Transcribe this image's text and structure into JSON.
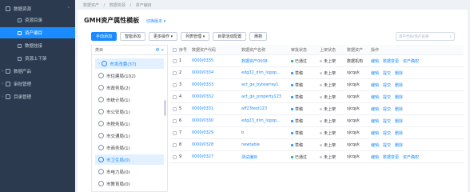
{
  "sidebar": {
    "groups": [
      {
        "label": "数据资源",
        "expanded": true
      },
      {
        "label": "数据产品",
        "expanded": false
      },
      {
        "label": "审批管理",
        "expanded": false
      },
      {
        "label": "目录管理",
        "expanded": false
      }
    ],
    "sub_items": [
      {
        "label": "资源目录"
      },
      {
        "label": "资产编目",
        "active": true
      },
      {
        "label": "数据挂接"
      },
      {
        "label": "资源上下架"
      }
    ]
  },
  "breadcrumb": [
    "数据资产",
    "/",
    "数据资源",
    "/",
    "资产编目"
  ],
  "panel": {
    "title": "GMH资产属性模板",
    "switch_label": "切换版本 ▾"
  },
  "toolbar": {
    "buttons": [
      "手动添加",
      "智能添加",
      "更多操作 ▾",
      "列表管理 ▾",
      "目录活动配置",
      "刷新"
    ]
  },
  "search": {
    "placeholder": "资产代码/资产名称"
  },
  "tree": {
    "header": "类目",
    "items": [
      {
        "label": "市发改委(37)",
        "selected": true
      },
      {
        "label": "市住建局(102)"
      },
      {
        "label": "市政务局(2)"
      },
      {
        "label": "市统计局(1)"
      },
      {
        "label": "市公安局(1)"
      },
      {
        "label": "市税务局(1)"
      },
      {
        "label": "市交通局(1)"
      },
      {
        "label": "市商务局(1)"
      },
      {
        "label": "市卫生局(0)",
        "highlight": true
      },
      {
        "label": "市电力局(0)"
      },
      {
        "label": "市教育局(0)"
      }
    ]
  },
  "table": {
    "headers": [
      "序号",
      "数据资产代码",
      "数据资产名称",
      "审批状态",
      "上架状态",
      "数据资产",
      "操作"
    ],
    "rows": [
      {
        "no": "1",
        "code": "0000/0335",
        "name": "数据资产0008",
        "audit": "已通过",
        "audit_color": "#1aa86b",
        "pub": "未上架",
        "prod": "数据机构",
        "ops": [
          "编辑",
          "数据变更",
          "资产确权"
        ]
      },
      {
        "no": "2",
        "code": "0000/0334",
        "name": "edg32_dim_logop...",
        "audit": "草稿",
        "audit_color": "#1a8cff",
        "pub": "未上架",
        "prod": "sjcqyk",
        "ops": [
          "编辑",
          "提交",
          "删除"
        ]
      },
      {
        "no": "3",
        "code": "0000/0333",
        "name": "act_ge_bytearray1",
        "audit": "草稿",
        "audit_color": "#1a8cff",
        "pub": "未上架",
        "prod": "sjcqyk",
        "ops": [
          "编辑",
          "提交",
          "删除"
        ]
      },
      {
        "no": "4",
        "code": "0000/0332",
        "name": "act_ge_property123",
        "audit": "草稿",
        "audit_color": "#1a8cff",
        "pub": "未上架",
        "prod": "sjcqyk",
        "ops": [
          "编辑",
          "提交",
          "删除"
        ]
      },
      {
        "no": "5",
        "code": "0000/0331",
        "name": "aff23test123",
        "audit": "草稿",
        "audit_color": "#1a8cff",
        "pub": "未上架",
        "prod": "sjcqyk",
        "ops": [
          "编辑",
          "提交",
          "删除"
        ]
      },
      {
        "no": "6",
        "code": "0000/0330",
        "name": "edg23_dim_logop...",
        "audit": "草稿",
        "audit_color": "#1a8cff",
        "pub": "未上架",
        "prod": "sjcqyk",
        "ops": [
          "编辑",
          "提交",
          "删除"
        ]
      },
      {
        "no": "7",
        "code": "0000/0329",
        "name": "b",
        "audit": "草稿",
        "audit_color": "#1a8cff",
        "pub": "未上架",
        "prod": "sjcqyk",
        "ops": [
          "编辑",
          "提交",
          "删除"
        ]
      },
      {
        "no": "8",
        "code": "0000/0328",
        "name": "newtable",
        "audit": "草稿",
        "audit_color": "#1a8cff",
        "pub": "未上架",
        "prod": "sjcqyk",
        "ops": [
          "编辑",
          "提交",
          "删除"
        ]
      },
      {
        "no": "9",
        "code": "0000/0327",
        "name": "测试编目",
        "audit": "已通过",
        "audit_color": "#1aa86b",
        "pub": "未上架",
        "prod": "sjcqyk",
        "ops": [
          "编辑",
          "数据变更",
          "资产确权"
        ]
      }
    ]
  }
}
